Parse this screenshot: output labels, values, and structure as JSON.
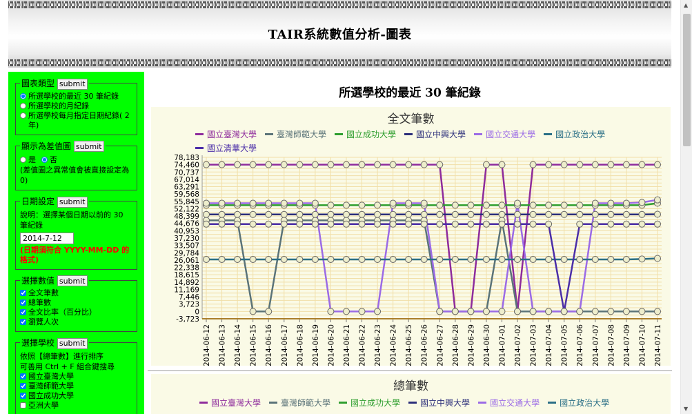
{
  "page": {
    "title": "TAIR系統數值分析-圖表"
  },
  "sidebar": {
    "chart_type": {
      "legend": "圖表類型",
      "submit": "submit",
      "options": [
        "所選學校的最近 30 筆紀錄",
        "所選學校的月紀錄",
        "所選學校每月指定日期紀錄( 2 年)"
      ],
      "selected": 0
    },
    "diff": {
      "legend": "顯示為差值圖",
      "submit": "submit",
      "yes": "是",
      "no": "否",
      "note": "(差值圖之異常值會被直接設定為 0)"
    },
    "date": {
      "legend": "日期設定",
      "submit": "submit",
      "desc": "說明：選擇某個日期以前的 30 筆紀錄",
      "value": "2014-7-12",
      "warning": "(日期須符合 YYYY-MM-DD 的格式)"
    },
    "values": {
      "legend": "選擇數值",
      "submit": "submit",
      "items": [
        "全文筆數",
        "總筆數",
        "全文比率（百分比）",
        "瀏覽人次"
      ]
    },
    "schools": {
      "legend": "選擇學校",
      "submit": "submit",
      "desc1": "依照【總筆數】進行排序",
      "desc2": "可善用 Ctrl + F 組合鍵搜尋",
      "items": [
        "國立臺灣大學",
        "臺灣師範大學",
        "國立成功大學",
        "亞洲大學"
      ],
      "checked": [
        true,
        true,
        true,
        false
      ]
    }
  },
  "main": {
    "heading": "所選學校的最近 30 筆紀錄"
  },
  "colors": {
    "ntu": "#8e2b9c",
    "ntnu": "#5a7378",
    "ncku": "#2e9e2e",
    "nchu": "#2b2e7a",
    "nctu": "#9b6be6",
    "nccu": "#2a6f86",
    "nthu": "#4b2ea8"
  },
  "chart_data": [
    {
      "type": "line",
      "title": "全文筆數",
      "yticks": [
        "78,183",
        "74,460",
        "70,737",
        "67,014",
        "63,291",
        "59,568",
        "55,845",
        "52,122",
        "48,399",
        "44,676",
        "40,953",
        "37,230",
        "33,507",
        "29,784",
        "26,061",
        "22,338",
        "18,615",
        "14,892",
        "11,169",
        "7,446",
        "3,723",
        "0",
        "-3,723"
      ],
      "ylim": [
        -3723,
        78183
      ],
      "categories": [
        "2014-06-12",
        "2014-06-13",
        "2014-06-14",
        "2014-06-15",
        "2014-06-16",
        "2014-06-17",
        "2014-06-18",
        "2014-06-19",
        "2014-06-20",
        "2014-06-21",
        "2014-06-22",
        "2014-06-23",
        "2014-06-24",
        "2014-06-25",
        "2014-06-26",
        "2014-06-27",
        "2014-06-28",
        "2014-06-29",
        "2014-06-30",
        "2014-07-01",
        "2014-07-02",
        "2014-07-03",
        "2014-07-04",
        "2014-07-05",
        "2014-07-06",
        "2014-07-07",
        "2014-07-08",
        "2014-07-09",
        "2014-07-10",
        "2014-07-11"
      ],
      "series": [
        {
          "name": "國立臺灣大學",
          "color": "#8e2b9c",
          "values": [
            74460,
            74460,
            74460,
            74460,
            74460,
            74460,
            74460,
            74460,
            74460,
            74460,
            74460,
            74460,
            74460,
            74460,
            74460,
            74460,
            0,
            0,
            74460,
            74460,
            0,
            74460,
            74460,
            74460,
            74460,
            74460,
            74460,
            74460,
            74460,
            74460
          ]
        },
        {
          "name": "臺灣師範大學",
          "color": "#5a7378",
          "values": [
            46200,
            46200,
            46200,
            0,
            0,
            46200,
            46200,
            46200,
            46200,
            46200,
            46200,
            46200,
            46200,
            46200,
            46200,
            0,
            0,
            0,
            0,
            46200,
            0,
            0,
            0,
            0,
            0,
            0,
            0,
            0,
            0,
            0
          ]
        },
        {
          "name": "國立成功大學",
          "color": "#2e9e2e",
          "values": [
            53900,
            53900,
            53900,
            53900,
            53900,
            53900,
            53900,
            53900,
            53900,
            53900,
            53900,
            53900,
            53900,
            53900,
            53900,
            53900,
            53900,
            53900,
            53900,
            53900,
            53900,
            53900,
            53900,
            53900,
            53900,
            53900,
            53900,
            53900,
            53900,
            54900
          ]
        },
        {
          "name": "國立中興大學",
          "color": "#2b2e7a",
          "values": [
            49200,
            49200,
            49200,
            49200,
            49200,
            49200,
            49200,
            49200,
            49200,
            49200,
            49200,
            49200,
            49200,
            49200,
            49200,
            49200,
            49200,
            49200,
            49200,
            49200,
            49200,
            49200,
            49200,
            49200,
            49200,
            49200,
            49200,
            49200,
            49200,
            49300
          ]
        },
        {
          "name": "國立交通大學",
          "color": "#9b6be6",
          "values": [
            54900,
            54900,
            54900,
            54900,
            54900,
            54900,
            54900,
            54900,
            0,
            0,
            0,
            0,
            54900,
            54900,
            54900,
            0,
            0,
            0,
            0,
            0,
            54900,
            0,
            0,
            0,
            0,
            54900,
            54900,
            54900,
            55300,
            56600
          ]
        },
        {
          "name": "國立政治大學",
          "color": "#2a6f86",
          "values": [
            26400,
            26400,
            26400,
            26400,
            26400,
            26400,
            26400,
            26400,
            26400,
            26400,
            26400,
            26400,
            26400,
            26400,
            26400,
            26400,
            26400,
            26400,
            26400,
            26400,
            26400,
            26400,
            26400,
            26400,
            26400,
            26400,
            26400,
            26400,
            26600,
            26900
          ]
        },
        {
          "name": "國立清華大學",
          "color": "#4b2ea8",
          "values": [
            44300,
            44300,
            44300,
            44300,
            44300,
            44300,
            44300,
            44300,
            44300,
            44300,
            44300,
            44300,
            44300,
            44300,
            44300,
            44300,
            44300,
            44300,
            44300,
            44300,
            44300,
            44300,
            44300,
            0,
            44300,
            44300,
            44300,
            44300,
            44300,
            44300
          ]
        }
      ]
    },
    {
      "type": "line",
      "title": "總筆數",
      "series": [
        {
          "name": "國立臺灣大學",
          "color": "#8e2b9c"
        },
        {
          "name": "臺灣師範大學",
          "color": "#5a7378"
        },
        {
          "name": "國立成功大學",
          "color": "#2e9e2e"
        },
        {
          "name": "國立中興大學",
          "color": "#2b2e7a"
        },
        {
          "name": "國立交通大學",
          "color": "#9b6be6"
        },
        {
          "name": "國立政治大學",
          "color": "#2a6f86"
        }
      ]
    }
  ]
}
